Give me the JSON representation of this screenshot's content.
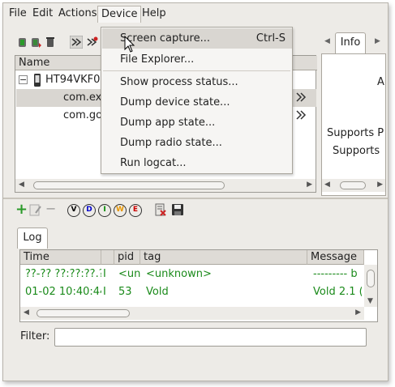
{
  "menubar": {
    "file": "File",
    "edit": "Edit",
    "actions": "Actions",
    "device": "Device",
    "help": "Help"
  },
  "device_tree": {
    "column_name": "Name",
    "device": "HT94VKF0",
    "processes": [
      "com.ex",
      "com.go"
    ]
  },
  "device_menu": {
    "items": [
      {
        "label": "Screen capture...",
        "shortcut": "Ctrl-S"
      },
      {
        "label": "File Explorer..."
      },
      {
        "label": "Show process status..."
      },
      {
        "label": "Dump device state..."
      },
      {
        "label": "Dump app state..."
      },
      {
        "label": "Dump radio state..."
      },
      {
        "label": "Run logcat..."
      }
    ]
  },
  "info_panel": {
    "tab": "Info",
    "lines": [
      "A",
      "Supports P",
      "Supports"
    ]
  },
  "log_toolbar": {
    "filters": [
      "V",
      "D",
      "I",
      "W",
      "E"
    ]
  },
  "log": {
    "tab": "Log",
    "columns": [
      "Time",
      "",
      "pid",
      "tag",
      "Message"
    ],
    "rows": [
      {
        "time": "??-?? ??:??:??.?",
        "level": "I",
        "pid": "<unk",
        "tag": "<unknown>",
        "message": "--------- b"
      },
      {
        "time": "01-02 10:40:44",
        "level": "I",
        "pid": "53",
        "tag": "Vold",
        "message": "Vold 2.1 ("
      }
    ]
  },
  "filter": {
    "label": "Filter:",
    "value": ""
  },
  "colors": {
    "log_text": "#1a8a1a",
    "verbose": "#000000",
    "debug": "#0000cc",
    "info": "#008800",
    "warn": "#e69500",
    "error": "#cc0000"
  }
}
